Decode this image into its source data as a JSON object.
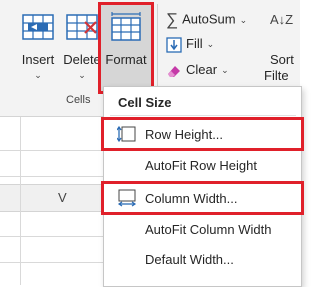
{
  "ribbon": {
    "insert_label": "Insert",
    "delete_label": "Delete",
    "format_label": "Format",
    "group_label": "Cells",
    "autosum_label": "AutoSum",
    "fill_label": "Fill",
    "clear_label": "Clear",
    "sort_label": "Sort",
    "filter_label": "Filte",
    "sigma_glyph": "∑",
    "dropdown_glyph": "⌄",
    "sort_glyph": "A↓Z"
  },
  "sheet": {
    "column_header": "V"
  },
  "menu": {
    "header": "Cell Size",
    "items": [
      {
        "label": "Row Height...",
        "icon": "row-height-icon",
        "highlighted": true
      },
      {
        "label": "AutoFit Row Height",
        "icon": "",
        "highlighted": false
      },
      {
        "label": "Column Width...",
        "icon": "column-width-icon",
        "highlighted": true
      },
      {
        "label": "AutoFit Column Width",
        "icon": "",
        "highlighted": false
      },
      {
        "label": "Default Width...",
        "icon": "",
        "highlighted": false
      }
    ]
  },
  "colors": {
    "highlight": "#e0202a",
    "icon_blue": "#2b6cb5",
    "icon_red": "#d13438",
    "clear_pink": "#c53aa8"
  }
}
